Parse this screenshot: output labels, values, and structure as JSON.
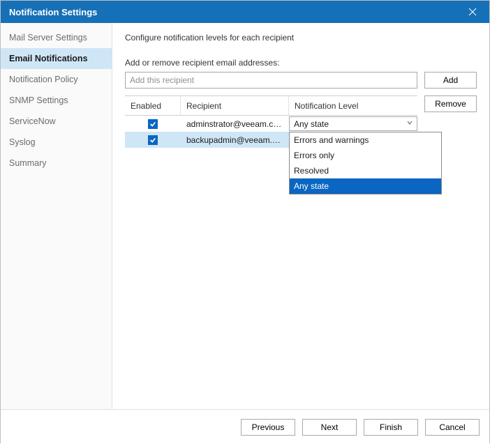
{
  "window": {
    "title": "Notification Settings"
  },
  "sidebar": {
    "items": [
      {
        "label": "Mail Server Settings",
        "active": false
      },
      {
        "label": "Email Notifications",
        "active": true
      },
      {
        "label": "Notification Policy",
        "active": false
      },
      {
        "label": "SNMP Settings",
        "active": false
      },
      {
        "label": "ServiceNow",
        "active": false
      },
      {
        "label": "Syslog",
        "active": false
      },
      {
        "label": "Summary",
        "active": false
      }
    ]
  },
  "main": {
    "description": "Configure notification levels for each recipient",
    "addremove_label": "Add or remove recipient email addresses:",
    "input_placeholder": "Add this recipient",
    "add_label": "Add",
    "remove_label": "Remove",
    "columns": {
      "enabled": "Enabled",
      "recipient": "Recipient",
      "level": "Notification Level"
    },
    "rows": [
      {
        "enabled": true,
        "recipient": "adminstrator@veeam.com",
        "level": "Any state",
        "selected": false,
        "dropdown_open": false
      },
      {
        "enabled": true,
        "recipient": "backupadmin@veeam.co...",
        "level": "Any state",
        "selected": true,
        "dropdown_open": true
      }
    ],
    "dropdown_options": [
      "Errors and warnings",
      "Errors only",
      "Resolved",
      "Any state"
    ],
    "dropdown_selected": "Any state"
  },
  "footer": {
    "previous": "Previous",
    "next": "Next",
    "finish": "Finish",
    "cancel": "Cancel"
  }
}
